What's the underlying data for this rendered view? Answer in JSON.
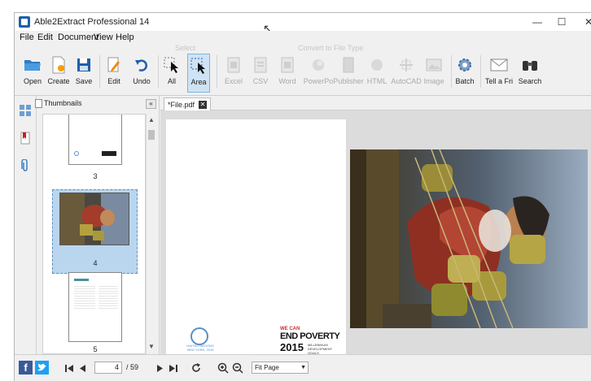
{
  "window": {
    "title": "Able2Extract Professional 14"
  },
  "menu": [
    "File",
    "Edit",
    "Document",
    "View",
    "Help"
  ],
  "toolbar": {
    "group_select": "Select",
    "group_convert": "Convert to File Type",
    "tools": {
      "open": "Open",
      "create": "Create",
      "save": "Save",
      "edit": "Edit",
      "undo": "Undo",
      "all": "All",
      "area": "Area",
      "excel": "Excel",
      "csv": "CSV",
      "word": "Word",
      "powerpoint": "PowerPo",
      "publisher": "Publisher",
      "html": "HTML",
      "autocad": "AutoCAD",
      "image": "Image",
      "batch": "Batch",
      "tell": "Tell a Fri",
      "search": "Search"
    }
  },
  "thumbnails": {
    "title": "Thumbnails",
    "pages": [
      {
        "number": "3"
      },
      {
        "number": "4"
      },
      {
        "number": "5"
      }
    ],
    "selected_page": "4"
  },
  "document_tab": {
    "label": "*File.pdf"
  },
  "page": {
    "un_caption": "UNITED NATIONS NEW YORK, 2015",
    "eop_top": "WE CAN",
    "eop_main": "END POVERTY",
    "eop_year": "2015",
    "eop_sub": "MILLENNIUM DEVELOPMENT GOALS"
  },
  "status": {
    "current_page": "4",
    "total_pages": "/ 59",
    "zoom": "Fit Page"
  },
  "colors": {
    "accent": "#1f5fa8",
    "selection": "#b9d6ee",
    "facebook": "#3b5998",
    "twitter": "#1da1f2"
  }
}
